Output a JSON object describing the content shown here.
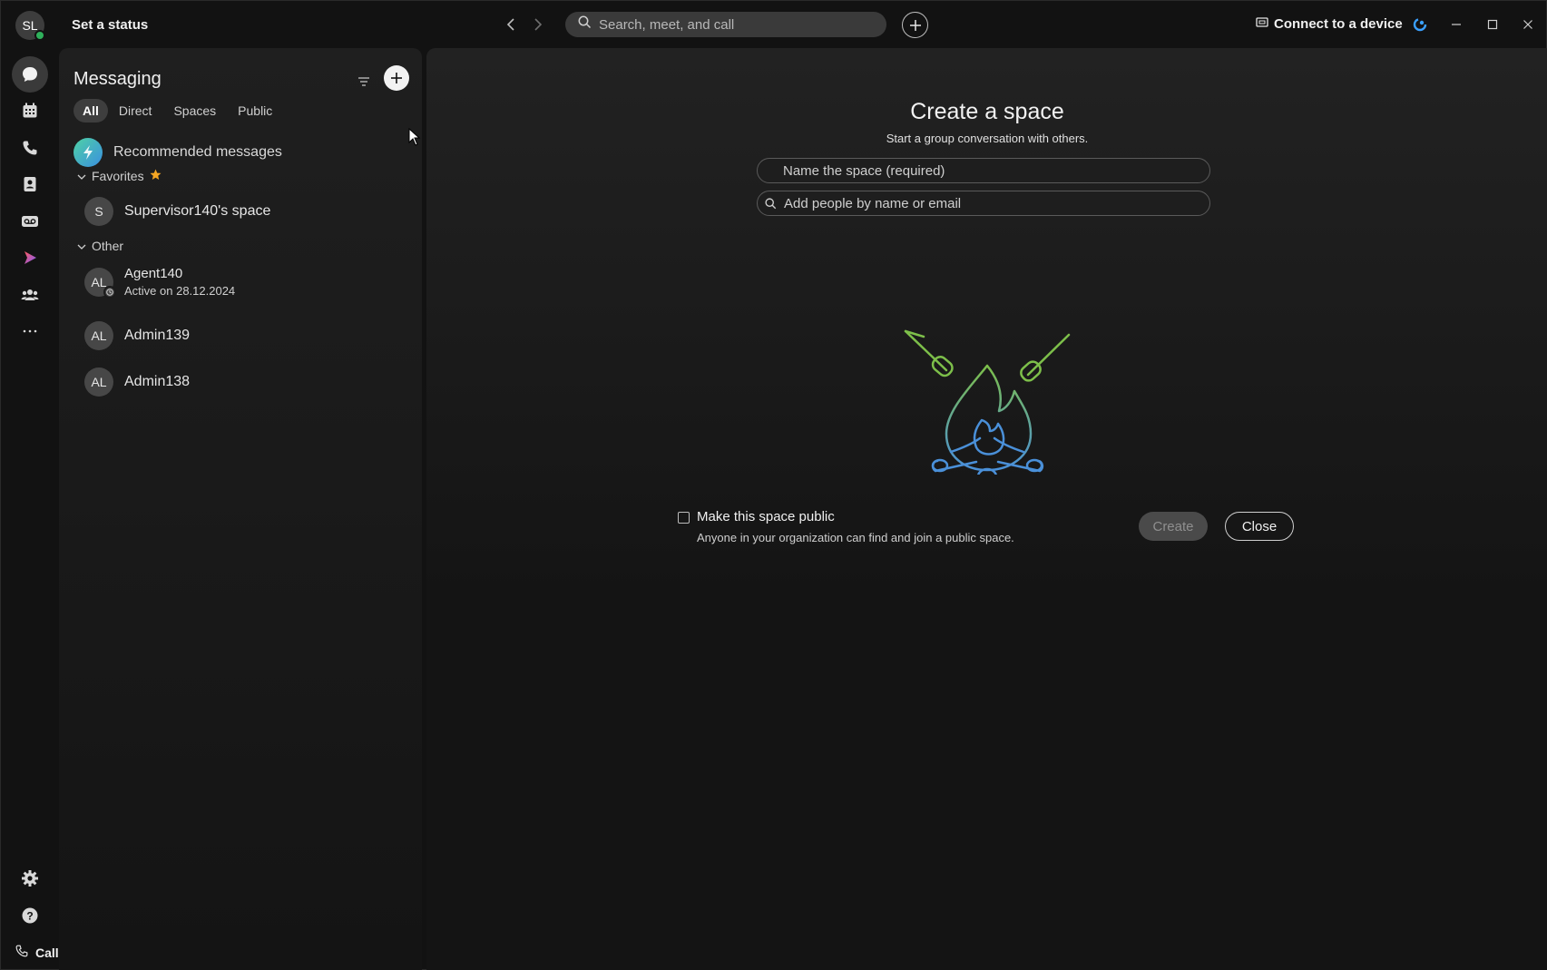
{
  "user": {
    "initials": "SL"
  },
  "titlebar": {
    "set_status": "Set a status",
    "search_placeholder": "Search, meet, and call",
    "connect_label": "Connect to a device"
  },
  "rail": {
    "items": [
      "messaging",
      "calendar",
      "calling",
      "contacts",
      "voicemail",
      "webex-app",
      "teams",
      "more"
    ],
    "call_settings": "Call settings"
  },
  "messaging": {
    "title": "Messaging",
    "tabs": [
      "All",
      "Direct",
      "Spaces",
      "Public"
    ],
    "active_tab": "All",
    "recommended": "Recommended messages",
    "favorites_label": "Favorites",
    "other_label": "Other",
    "favorites": [
      {
        "initials": "S",
        "name": "Supervisor140's space"
      }
    ],
    "other": [
      {
        "initials": "AL",
        "name": "Agent140",
        "status": "Active on 28.12.2024"
      },
      {
        "initials": "AL",
        "name": "Admin139"
      },
      {
        "initials": "AL",
        "name": "Admin138"
      }
    ]
  },
  "create_space": {
    "title": "Create a space",
    "subtitle": "Start a group conversation with others.",
    "name_placeholder": "Name the space (required)",
    "people_placeholder": "Add people by name or email",
    "public_label": "Make this space public",
    "public_desc": "Anyone in your organization can find and join a public space.",
    "create_label": "Create",
    "close_label": "Close"
  },
  "colors": {
    "background": "#121212",
    "presence_green": "#2fb05b",
    "favorite_star": "#f5a623",
    "illustration_green": "#7dbf4a",
    "illustration_blue": "#4a90d9"
  }
}
